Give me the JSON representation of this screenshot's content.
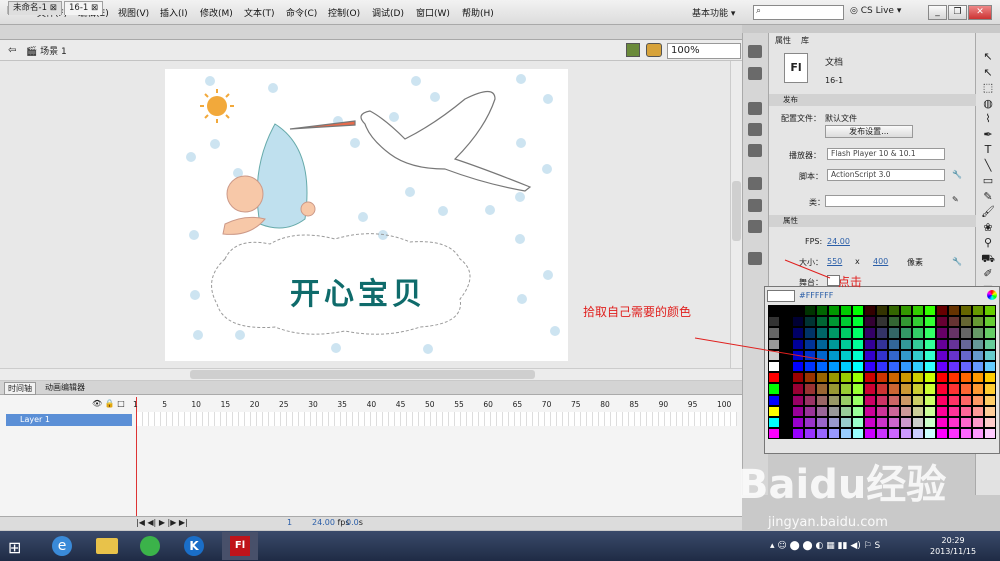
{
  "app": {
    "logo": "Fl",
    "menus": [
      "文件(F)",
      "编辑(E)",
      "视图(V)",
      "插入(I)",
      "修改(M)",
      "文本(T)",
      "命令(C)",
      "控制(O)",
      "调试(D)",
      "窗口(W)",
      "帮助(H)"
    ],
    "workspace": "基本功能",
    "cs_live": "CS Live"
  },
  "tabs": [
    {
      "label": "未命名-1"
    },
    {
      "label": "16-1"
    }
  ],
  "scene": {
    "label": "场景 1",
    "zoom": "100%"
  },
  "stage": {
    "title": "开心宝贝"
  },
  "timeline": {
    "tabs": [
      "时间轴",
      "动画编辑器"
    ],
    "layer": "Layer 1",
    "frames": [
      "1",
      "5",
      "10",
      "15",
      "20",
      "25",
      "30",
      "35",
      "40",
      "45",
      "50",
      "55",
      "60",
      "65",
      "70",
      "75",
      "80",
      "85",
      "90",
      "95",
      "100"
    ],
    "status": {
      "frame": "1",
      "fps": "24.00",
      "fps_unit": "fps",
      "time": "0.0",
      "time_unit": "s"
    }
  },
  "panel": {
    "tabs": [
      "属性",
      "库"
    ],
    "doc_type": "文档",
    "doc_name": "16-1",
    "publish": {
      "section": "发布",
      "profile_label": "配置文件：",
      "profile": "默认文件",
      "settings_button": "发布设置...",
      "player_label": "播放器：",
      "player": "Flash Player 10 & 10.1",
      "script_label": "脚本：",
      "script": "ActionScript 3.0",
      "class_label": "类："
    },
    "props": {
      "section": "属性",
      "fps_label": "FPS:",
      "fps": "24.00",
      "size_label": "大小：",
      "width": "550",
      "x": "x",
      "height": "400",
      "unit": "像素",
      "stage_label": "舞台："
    }
  },
  "swatch": {
    "hex": "#FFFFFF"
  },
  "annotations": {
    "pick": "拾取自己需要的颜色",
    "click": "点击"
  },
  "watermark": {
    "text": "Baidu经验",
    "url": "jingyan.baidu.com"
  },
  "clock": {
    "time": "20:29",
    "date": "2013/11/15"
  },
  "colors": {
    "accent": "#2a5ea8",
    "annotation": "#e0201e",
    "title": "#0f6b6b"
  }
}
